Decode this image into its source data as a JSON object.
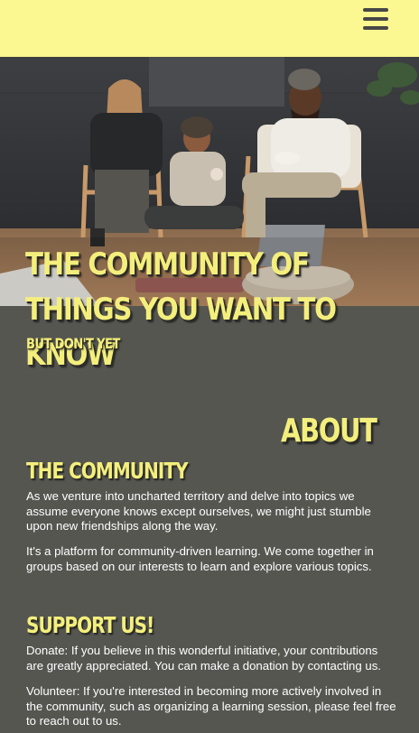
{
  "header": {
    "menu_icon": "hamburger-menu-icon",
    "background_color": "#fbf791"
  },
  "hero": {
    "image_description_icon": "hero-photo",
    "headline": "THE COMMUNITY OF THINGS YOU WANT TO KNOW",
    "subheadline": "BUT DON'T YET"
  },
  "about": {
    "title": "ABOUT",
    "community": {
      "title": "THE COMMUNITY",
      "paragraphs": [
        "As we venture into uncharted territory and delve into topics we assume everyone knows except ourselves, we might just stumble upon new friendships along the way.",
        "It's a platform for community-driven learning. We come together in groups based on our interests to learn and explore various topics."
      ]
    },
    "support": {
      "title": "SUPPORT US!",
      "paragraphs": [
        "Donate: If you believe in this wonderful initiative, your contributions are greatly appreciated. You can make a donation by contacting us.",
        "Volunteer: If you're interested in becoming more actively involved in the community, such as organizing a learning session, please feel free to reach out to us."
      ]
    }
  },
  "colors": {
    "accent_yellow": "#f4ef7c",
    "page_background": "#555650",
    "text": "#ffffff"
  }
}
